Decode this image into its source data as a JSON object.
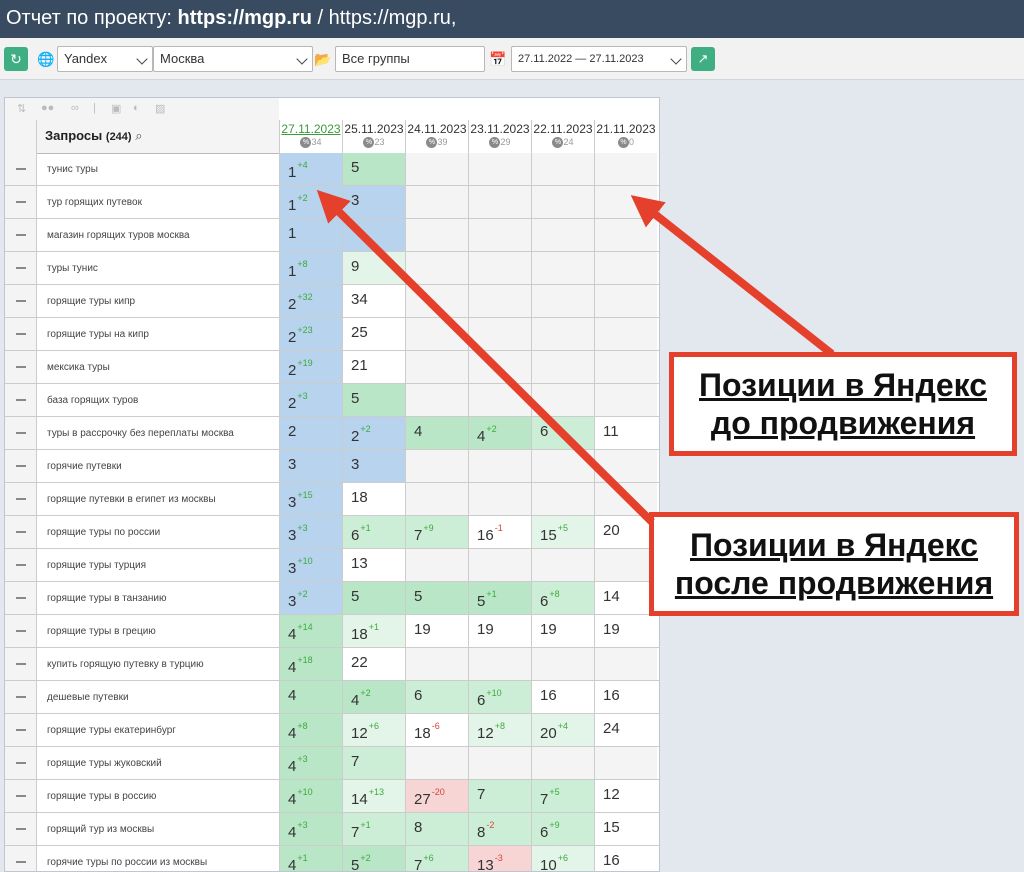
{
  "title": {
    "prefix": "Отчет по проекту: ",
    "project": "https://mgp.ru",
    "suffix": " / https://mgp.ru,"
  },
  "toolbar": {
    "engine": "Yandex",
    "region": "Москва",
    "group": "Все группы",
    "daterange": "27.11.2022 — 27.11.2023"
  },
  "table": {
    "query_header": "Запросы",
    "query_count": "(244)",
    "dates": [
      "27.11.2023",
      "25.11.2023",
      "24.11.2023",
      "23.11.2023",
      "22.11.2023",
      "21.11.2023"
    ],
    "pcts": [
      "34",
      "23",
      "39",
      "29",
      "24",
      "0"
    ],
    "rows": [
      {
        "q": "тунис туры",
        "cells": [
          {
            "v": "1",
            "d": "4",
            "s": "up",
            "c": "blue"
          },
          {
            "v": "5",
            "c": "g1"
          },
          {
            "c": "empty"
          },
          {
            "c": "empty"
          },
          {
            "c": "empty"
          },
          {
            "c": "empty"
          }
        ]
      },
      {
        "q": "тур горящих путевок",
        "cells": [
          {
            "v": "1",
            "d": "2",
            "s": "up",
            "c": "blue"
          },
          {
            "v": "3",
            "c": "blue"
          },
          {
            "c": "empty"
          },
          {
            "c": "empty"
          },
          {
            "c": "empty"
          },
          {
            "c": "empty"
          }
        ]
      },
      {
        "q": "магазин горящих туров москва",
        "cells": [
          {
            "v": "1",
            "c": "blue"
          },
          {
            "v": "",
            "c": "blue"
          },
          {
            "c": "empty"
          },
          {
            "c": "empty"
          },
          {
            "c": "empty"
          },
          {
            "c": "empty"
          }
        ]
      },
      {
        "q": "туры тунис",
        "cells": [
          {
            "v": "1",
            "d": "8",
            "s": "up",
            "c": "blue"
          },
          {
            "v": "9",
            "c": "g3"
          },
          {
            "c": "empty"
          },
          {
            "c": "empty"
          },
          {
            "c": "empty"
          },
          {
            "c": "empty"
          }
        ]
      },
      {
        "q": "горящие туры кипр",
        "cells": [
          {
            "v": "2",
            "d": "32",
            "s": "up",
            "c": "blue"
          },
          {
            "v": "34",
            "c": "white"
          },
          {
            "c": "empty"
          },
          {
            "c": "empty"
          },
          {
            "c": "empty"
          },
          {
            "c": "empty"
          }
        ]
      },
      {
        "q": "горящие туры на кипр",
        "cells": [
          {
            "v": "2",
            "d": "23",
            "s": "up",
            "c": "blue"
          },
          {
            "v": "25",
            "c": "white"
          },
          {
            "c": "empty"
          },
          {
            "c": "empty"
          },
          {
            "c": "empty"
          },
          {
            "c": "empty"
          }
        ]
      },
      {
        "q": "мексика туры",
        "cells": [
          {
            "v": "2",
            "d": "19",
            "s": "up",
            "c": "blue"
          },
          {
            "v": "21",
            "c": "white"
          },
          {
            "c": "empty"
          },
          {
            "c": "empty"
          },
          {
            "c": "empty"
          },
          {
            "c": "empty"
          }
        ]
      },
      {
        "q": "база горящих туров",
        "cells": [
          {
            "v": "2",
            "d": "3",
            "s": "up",
            "c": "blue"
          },
          {
            "v": "5",
            "c": "g1"
          },
          {
            "c": "empty"
          },
          {
            "c": "empty"
          },
          {
            "c": "empty"
          },
          {
            "c": "empty"
          }
        ]
      },
      {
        "q": "туры в рассрочку без переплаты москва",
        "cells": [
          {
            "v": "2",
            "c": "blue"
          },
          {
            "v": "2",
            "d": "2",
            "s": "up",
            "c": "blue"
          },
          {
            "v": "4",
            "c": "g1"
          },
          {
            "v": "4",
            "d": "2",
            "s": "up",
            "c": "g1"
          },
          {
            "v": "6",
            "c": "g2"
          },
          {
            "v": "11",
            "c": "white"
          }
        ]
      },
      {
        "q": "горячие путевки",
        "cells": [
          {
            "v": "3",
            "c": "blue"
          },
          {
            "v": "3",
            "c": "blue"
          },
          {
            "c": "empty"
          },
          {
            "c": "empty"
          },
          {
            "c": "empty"
          },
          {
            "c": "empty"
          }
        ]
      },
      {
        "q": "горящие путевки в египет из москвы",
        "cells": [
          {
            "v": "3",
            "d": "15",
            "s": "up",
            "c": "blue"
          },
          {
            "v": "18",
            "c": "white"
          },
          {
            "c": "empty"
          },
          {
            "c": "empty"
          },
          {
            "c": "empty"
          },
          {
            "c": "empty"
          }
        ]
      },
      {
        "q": "горящие туры по россии",
        "cells": [
          {
            "v": "3",
            "d": "3",
            "s": "up",
            "c": "blue"
          },
          {
            "v": "6",
            "d": "1",
            "s": "up",
            "c": "g2"
          },
          {
            "v": "7",
            "d": "9",
            "s": "up",
            "c": "g2"
          },
          {
            "v": "16",
            "d": "1",
            "s": "dn",
            "c": "white"
          },
          {
            "v": "15",
            "d": "5",
            "s": "up",
            "c": "g3"
          },
          {
            "v": "20",
            "c": "white"
          }
        ]
      },
      {
        "q": "горящие туры турция",
        "cells": [
          {
            "v": "3",
            "d": "10",
            "s": "up",
            "c": "blue"
          },
          {
            "v": "13",
            "c": "white"
          },
          {
            "c": "empty"
          },
          {
            "c": "empty"
          },
          {
            "c": "empty"
          },
          {
            "c": "empty"
          }
        ]
      },
      {
        "q": "горящие туры в танзанию",
        "cells": [
          {
            "v": "3",
            "d": "2",
            "s": "up",
            "c": "blue"
          },
          {
            "v": "5",
            "c": "g1"
          },
          {
            "v": "5",
            "c": "g1"
          },
          {
            "v": "5",
            "d": "1",
            "s": "up",
            "c": "g1"
          },
          {
            "v": "6",
            "d": "8",
            "s": "up",
            "c": "g2"
          },
          {
            "v": "14",
            "c": "white"
          }
        ]
      },
      {
        "q": "горящие туры в грецию",
        "cells": [
          {
            "v": "4",
            "d": "14",
            "s": "up",
            "c": "g1"
          },
          {
            "v": "18",
            "d": "1",
            "s": "up",
            "c": "g3"
          },
          {
            "v": "19",
            "c": "white"
          },
          {
            "v": "19",
            "c": "white"
          },
          {
            "v": "19",
            "c": "white"
          },
          {
            "v": "19",
            "c": "white"
          }
        ]
      },
      {
        "q": "купить горящую путевку в турцию",
        "cells": [
          {
            "v": "4",
            "d": "18",
            "s": "up",
            "c": "g1"
          },
          {
            "v": "22",
            "c": "white"
          },
          {
            "c": "empty"
          },
          {
            "c": "empty"
          },
          {
            "c": "empty"
          },
          {
            "c": "empty"
          }
        ]
      },
      {
        "q": "дешевые путевки",
        "cells": [
          {
            "v": "4",
            "c": "g1"
          },
          {
            "v": "4",
            "d": "2",
            "s": "up",
            "c": "g1"
          },
          {
            "v": "6",
            "c": "g2"
          },
          {
            "v": "6",
            "d": "10",
            "s": "up",
            "c": "g2"
          },
          {
            "v": "16",
            "c": "white"
          },
          {
            "v": "16",
            "c": "white"
          }
        ]
      },
      {
        "q": "горящие туры екатеринбург",
        "cells": [
          {
            "v": "4",
            "d": "8",
            "s": "up",
            "c": "g1"
          },
          {
            "v": "12",
            "d": "6",
            "s": "up",
            "c": "g3"
          },
          {
            "v": "18",
            "d": "6",
            "s": "dn",
            "c": "white"
          },
          {
            "v": "12",
            "d": "8",
            "s": "up",
            "c": "g3"
          },
          {
            "v": "20",
            "d": "4",
            "s": "up",
            "c": "g3"
          },
          {
            "v": "24",
            "c": "white"
          }
        ]
      },
      {
        "q": "горящие туры жуковский",
        "cells": [
          {
            "v": "4",
            "d": "3",
            "s": "up",
            "c": "g1"
          },
          {
            "v": "7",
            "c": "g2"
          },
          {
            "c": "empty"
          },
          {
            "c": "empty"
          },
          {
            "c": "empty"
          },
          {
            "c": "empty"
          }
        ]
      },
      {
        "q": "горящие туры в россию",
        "cells": [
          {
            "v": "4",
            "d": "10",
            "s": "up",
            "c": "g1"
          },
          {
            "v": "14",
            "d": "13",
            "s": "up",
            "c": "g3"
          },
          {
            "v": "27",
            "d": "20",
            "s": "dn",
            "c": "red"
          },
          {
            "v": "7",
            "c": "g2"
          },
          {
            "v": "7",
            "d": "5",
            "s": "up",
            "c": "g2"
          },
          {
            "v": "12",
            "c": "white"
          }
        ]
      },
      {
        "q": "горящий тур из москвы",
        "cells": [
          {
            "v": "4",
            "d": "3",
            "s": "up",
            "c": "g1"
          },
          {
            "v": "7",
            "d": "1",
            "s": "up",
            "c": "g2"
          },
          {
            "v": "8",
            "c": "g2"
          },
          {
            "v": "8",
            "d": "2",
            "s": "dn",
            "c": "g2"
          },
          {
            "v": "6",
            "d": "9",
            "s": "up",
            "c": "g2"
          },
          {
            "v": "15",
            "c": "white"
          }
        ]
      },
      {
        "q": "горячие туры по россии из москвы",
        "cells": [
          {
            "v": "4",
            "d": "1",
            "s": "up",
            "c": "g1"
          },
          {
            "v": "5",
            "d": "2",
            "s": "up",
            "c": "g1"
          },
          {
            "v": "7",
            "d": "6",
            "s": "up",
            "c": "g2"
          },
          {
            "v": "13",
            "d": "3",
            "s": "dn",
            "c": "red"
          },
          {
            "v": "10",
            "d": "6",
            "s": "up",
            "c": "g3"
          },
          {
            "v": "16",
            "c": "white"
          }
        ]
      }
    ]
  },
  "callouts": {
    "before": [
      "Позиции в Яндекс",
      "до продвижения"
    ],
    "after": [
      "Позиции в Яндекс",
      "после продвижения"
    ],
    "color": "#e5402b"
  },
  "icons": {
    "refresh": "refresh-icon",
    "globe": "globe-icon",
    "folder": "folder-icon",
    "calendar": "calendar-icon",
    "export": "export-icon",
    "search": "search-icon"
  }
}
